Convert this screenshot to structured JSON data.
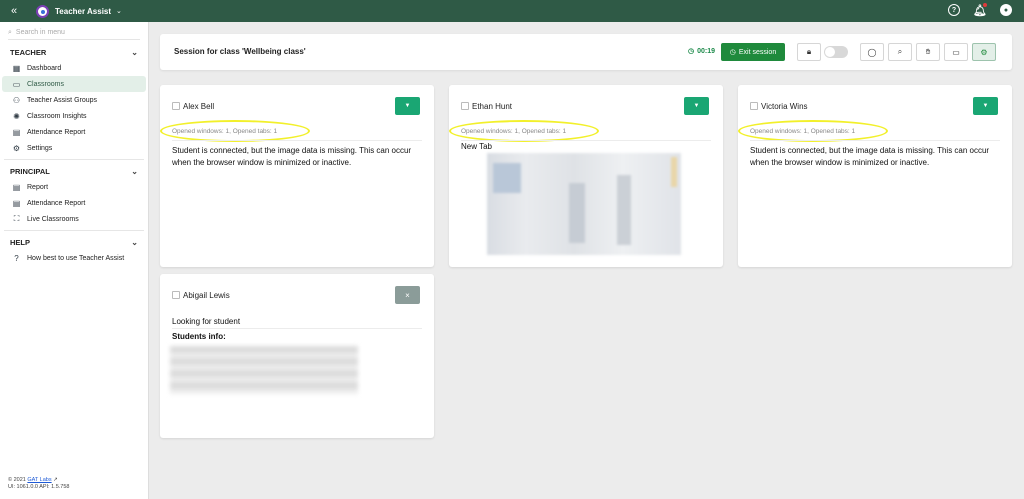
{
  "topbar": {
    "app_name": "Teacher Assist",
    "icons": [
      "double-chevron-left-icon",
      "help-icon",
      "bell-icon",
      "user-icon"
    ]
  },
  "sidebar": {
    "search_placeholder": "Search in menu",
    "sections": [
      {
        "title": "TEACHER",
        "items": [
          {
            "label": "Dashboard",
            "icon": "dashboard-icon"
          },
          {
            "label": "Classrooms",
            "icon": "classroom-icon",
            "active": true
          },
          {
            "label": "Teacher Assist Groups",
            "icon": "groups-icon"
          },
          {
            "label": "Classroom Insights",
            "icon": "lightbulb-icon"
          },
          {
            "label": "Attendance Report",
            "icon": "report-icon"
          },
          {
            "label": "Settings",
            "icon": "gear-icon"
          }
        ]
      },
      {
        "title": "PRINCIPAL",
        "items": [
          {
            "label": "Report",
            "icon": "report-icon"
          },
          {
            "label": "Attendance Report",
            "icon": "report-icon"
          },
          {
            "label": "Live Classrooms",
            "icon": "live-icon"
          }
        ]
      },
      {
        "title": "HELP",
        "items": [
          {
            "label": "How best to use Teacher Assist",
            "icon": "question-icon"
          }
        ]
      }
    ],
    "footer": {
      "copyright": "© 2021",
      "company_link": "GAT Labs",
      "version": "UI: 1061.0.0 API: 1.5.758"
    }
  },
  "session": {
    "title": "Session for class 'Wellbeing class'",
    "timer": "00:19",
    "exit_label": "Exit session"
  },
  "cards": [
    {
      "name": "Alex Bell",
      "meta": "Opened windows: 1, Opened tabs: 1",
      "message": "Student is connected, but the image data is missing. This can occur when the browser window is minimized or inactive."
    },
    {
      "name": "Ethan Hunt",
      "meta": "Opened windows: 1, Opened tabs: 1",
      "tab_title": "New Tab"
    },
    {
      "name": "Victoria Wins",
      "meta": "Opened windows: 1, Opened tabs: 1",
      "message": "Student is connected, but the image data is missing. This can occur when the browser window is minimized or inactive."
    },
    {
      "name": "Abigail Lewis",
      "status": "Looking for student",
      "info_label": "Students info:"
    }
  ],
  "colors": {
    "topbar": "#2f5a46",
    "accent_green": "#1f8a3c",
    "card_button": "#1aa673",
    "highlight": "#f2f02a"
  }
}
